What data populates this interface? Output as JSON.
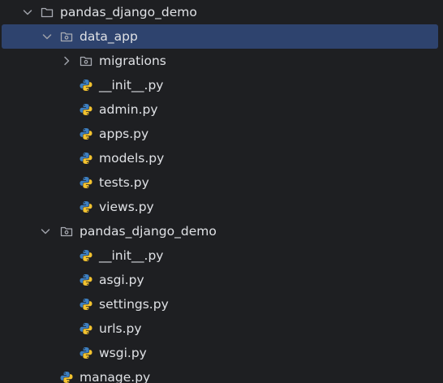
{
  "project_tree": {
    "root": {
      "label": "pandas_django_demo",
      "icon": "folder-icon",
      "expanded": true
    },
    "data_app": {
      "label": "data_app",
      "icon": "package-folder-icon",
      "expanded": true,
      "selected": true,
      "children": [
        {
          "label": "migrations",
          "icon": "package-folder-icon",
          "expanded": false
        },
        {
          "label": "__init__.py",
          "icon": "python-file-icon"
        },
        {
          "label": "admin.py",
          "icon": "python-file-icon"
        },
        {
          "label": "apps.py",
          "icon": "python-file-icon"
        },
        {
          "label": "models.py",
          "icon": "python-file-icon"
        },
        {
          "label": "tests.py",
          "icon": "python-file-icon"
        },
        {
          "label": "views.py",
          "icon": "python-file-icon"
        }
      ]
    },
    "project_pkg": {
      "label": "pandas_django_demo",
      "icon": "package-folder-icon",
      "expanded": true,
      "children": [
        {
          "label": "__init__.py",
          "icon": "python-file-icon"
        },
        {
          "label": "asgi.py",
          "icon": "python-file-icon"
        },
        {
          "label": "settings.py",
          "icon": "python-file-icon"
        },
        {
          "label": "urls.py",
          "icon": "python-file-icon"
        },
        {
          "label": "wsgi.py",
          "icon": "python-file-icon"
        }
      ]
    },
    "manage": {
      "label": "manage.py",
      "icon": "python-file-icon"
    }
  },
  "colors": {
    "background": "#1e1f22",
    "selection": "#2e436e",
    "text": "#dfe1e5",
    "chevron": "#9da0a8",
    "folder_stroke": "#a8abb3",
    "python_blue": "#3d7fc1",
    "python_yellow": "#f2c230"
  }
}
